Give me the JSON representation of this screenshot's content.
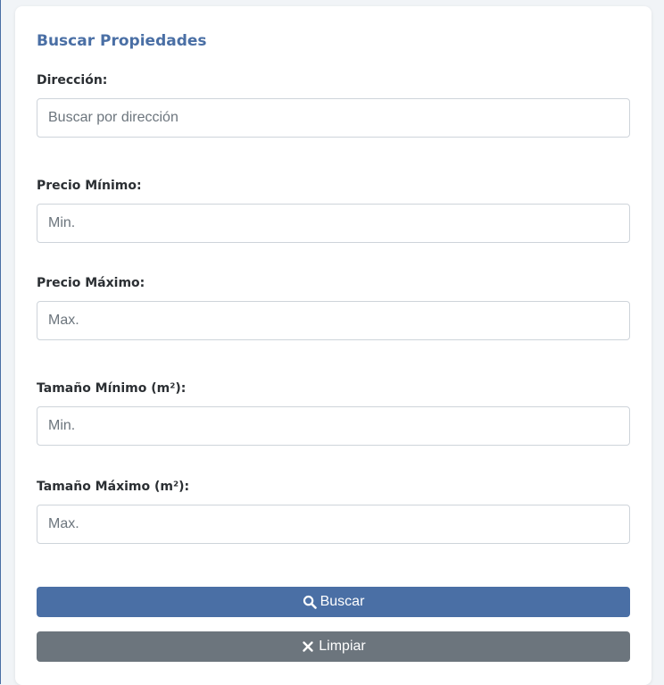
{
  "form": {
    "title": "Buscar Propiedades",
    "fields": [
      {
        "label": "Dirección:",
        "placeholder": "Buscar por dirección",
        "value": ""
      },
      {
        "label": "Precio Mínimo:",
        "placeholder": "Min.",
        "value": ""
      },
      {
        "label": "Precio Máximo:",
        "placeholder": "Max.",
        "value": ""
      },
      {
        "label": "Tamaño Mínimo (m²):",
        "placeholder": "Min.",
        "value": ""
      },
      {
        "label": "Tamaño Máximo (m²):",
        "placeholder": "Max.",
        "value": ""
      }
    ],
    "buttons": {
      "search_label": "Buscar",
      "search_icon": "search-icon",
      "clear_label": "Limpiar",
      "clear_icon": "close-icon"
    }
  },
  "colors": {
    "primary": "#4a6fa5",
    "secondary": "#6c757d",
    "background": "#f1f4f7"
  }
}
